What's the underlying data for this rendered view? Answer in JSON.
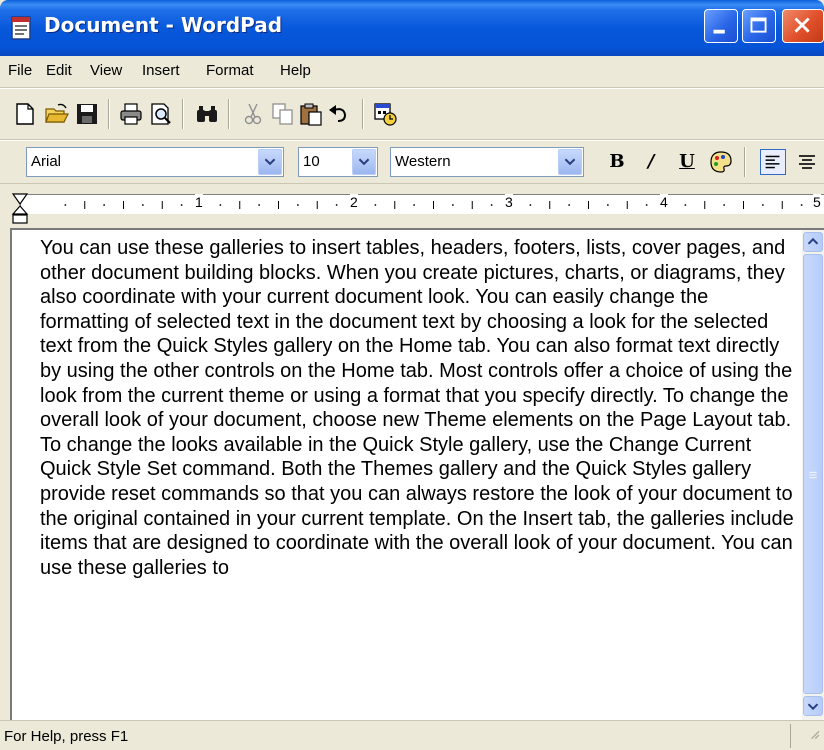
{
  "window": {
    "title": "Document - WordPad"
  },
  "menu": [
    "File",
    "Edit",
    "View",
    "Insert",
    "Format",
    "Help"
  ],
  "toolbar": {
    "buttons": [
      "new-icon",
      "open-icon",
      "save-icon",
      "print-icon",
      "print-preview-icon",
      "find-icon",
      "cut-icon",
      "copy-icon",
      "paste-icon",
      "undo-icon",
      "date-time-icon"
    ]
  },
  "format": {
    "font": "Arial",
    "size": "10",
    "script": "Western",
    "bold_label": "B",
    "italic_label": "/",
    "underline_label": "U"
  },
  "ruler": {
    "numbers": [
      "1",
      "2",
      "3",
      "4",
      "5"
    ]
  },
  "document": {
    "text": "You can use these galleries to insert tables, headers, footers, lists, cover pages, and other document building blocks. When you create pictures, charts, or diagrams, they also coordinate with your current document look. You can easily change the formatting of selected text in the document text by choosing a look for the selected text from the Quick Styles gallery on the Home tab. You can also format text directly by using the other controls on the Home tab. Most controls offer a choice of using the look from the current theme or using a format that you specify directly. To change the overall look of your document, choose new Theme elements on the Page Layout tab. To change the looks available in the Quick Style gallery, use the Change Current Quick Style Set command. Both the Themes gallery and the Quick Styles gallery provide reset commands so that you can always restore the look of your document to the original contained in your current template. On the Insert tab, the galleries include items that are designed to coordinate with the overall look of your document. You can use these galleries to"
  },
  "status": {
    "text": "For Help, press F1"
  },
  "colors": {
    "titlebar": "#0553d6",
    "chrome": "#ece9d8",
    "close": "#e0502a"
  }
}
